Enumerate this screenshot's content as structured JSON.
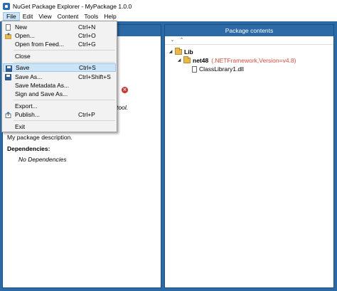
{
  "window": {
    "title": "NuGet Package Explorer - MyPackage 1.0.0"
  },
  "menubar": {
    "items": [
      {
        "label": "File",
        "active": true
      },
      {
        "label": "Edit"
      },
      {
        "label": "View"
      },
      {
        "label": "Content"
      },
      {
        "label": "Tools"
      },
      {
        "label": "Help"
      }
    ]
  },
  "file_menu": {
    "new": {
      "label": "New",
      "shortcut": "Ctrl+N"
    },
    "open": {
      "label": "Open...",
      "shortcut": "Ctrl+O"
    },
    "open_feed": {
      "label": "Open from Feed...",
      "shortcut": "Ctrl+G"
    },
    "close": {
      "label": "Close"
    },
    "save": {
      "label": "Save",
      "shortcut": "Ctrl+S"
    },
    "save_as": {
      "label": "Save As...",
      "shortcut": "Ctrl+Shift+S"
    },
    "save_metadata": {
      "label": "Save Metadata As..."
    },
    "sign_save": {
      "label": "Sign and Save As..."
    },
    "export": {
      "label": "Export..."
    },
    "publish": {
      "label": "Publish...",
      "shortcut": "Ctrl+P"
    },
    "exit": {
      "label": "Exit"
    }
  },
  "left_pane": {
    "tool_text": "tool.",
    "description": "My package description.",
    "dependencies_label": "Dependencies:",
    "dependencies_value": "No Dependencies"
  },
  "right_pane": {
    "title": "Package contents",
    "tree": {
      "lib": "Lib",
      "net48": "net48",
      "net48_note": "(.NETFramework,Version=v4.8)",
      "dll": "ClassLibrary1.dll"
    }
  }
}
